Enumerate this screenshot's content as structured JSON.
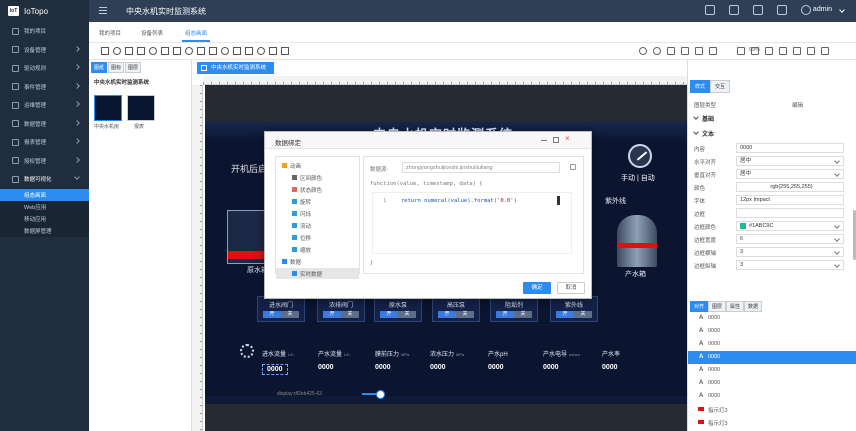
{
  "app": {
    "logo_badge": "IoT",
    "logo_text": "IoTopo",
    "window_title": "中央水机实时监测系统",
    "user": "admin"
  },
  "sidebar": {
    "items": [
      {
        "label": "我的项目",
        "chev": false
      },
      {
        "label": "设备管理",
        "chev": true
      },
      {
        "label": "驱动规则",
        "chev": true
      },
      {
        "label": "事件管理",
        "chev": true
      },
      {
        "label": "运维管理",
        "chev": true
      },
      {
        "label": "数据管理",
        "chev": true
      },
      {
        "label": "报表管理",
        "chev": true
      },
      {
        "label": "授权管理",
        "chev": true
      },
      {
        "label": "数据可视化",
        "chev": true,
        "open": true
      }
    ],
    "subitems": [
      {
        "label": "组态画面",
        "active": true
      },
      {
        "label": "Web应用"
      },
      {
        "label": "移动应用"
      },
      {
        "label": "数据屏管理"
      }
    ]
  },
  "tabs": [
    {
      "label": "我的项目"
    },
    {
      "label": "设备列表"
    },
    {
      "label": "组态画面",
      "active": true
    }
  ],
  "toolbar": {
    "zoom": "99%"
  },
  "left_panel": {
    "tabs": [
      "图纸",
      "图标",
      "图层"
    ],
    "tree_root": "中央水机实时监测系统",
    "thumbs": [
      {
        "label": "中央水机房",
        "selected": true
      },
      {
        "label": "报表"
      }
    ]
  },
  "canvas": {
    "doc_tab": "中央水机实时监测系统",
    "screen_title": "中央水机实时监测系统",
    "hint": "开机后启动",
    "left_tank_label": "原水箱",
    "right_tank_label": "产水箱",
    "uv_label": "紫外线",
    "mode_label": "手动 | 自动",
    "valves": [
      {
        "name": "进水阀门",
        "on": "开",
        "off": "关"
      },
      {
        "name": "浓排阀门",
        "on": "开",
        "off": "关"
      },
      {
        "name": "原水泵",
        "on": "开",
        "off": "关"
      },
      {
        "name": "高压泵",
        "on": "开",
        "off": "关"
      },
      {
        "name": "阻垢剂",
        "on": "开",
        "off": "关"
      },
      {
        "name": "紫外线",
        "on": "开",
        "off": "关"
      }
    ],
    "sensors": [
      {
        "name": "进水流量",
        "unit": "L/h",
        "value": "0000",
        "selected": true
      },
      {
        "name": "产水流量",
        "unit": "L/h",
        "value": "0000"
      },
      {
        "name": "膜前压力",
        "unit": "MPa",
        "value": "0000"
      },
      {
        "name": "浓水压力",
        "unit": "MPa",
        "value": "0000"
      },
      {
        "name": "产水pH",
        "unit": "",
        "value": "0000"
      },
      {
        "name": "产水电导",
        "unit": "us/cm",
        "value": "0000"
      },
      {
        "name": "产水率",
        "unit": "",
        "value": "0000"
      }
    ],
    "coord_text": "display:df2eb425-63",
    "zoom_fraction": 0.65
  },
  "modal": {
    "title": "数据绑定",
    "tree": [
      {
        "label": "动画",
        "icon_color": "#f0a020",
        "indent": 0
      },
      {
        "label": "区间颜色",
        "icon_color": "#666666",
        "indent": 1
      },
      {
        "label": "状态颜色",
        "icon_color": "#e06666",
        "indent": 1
      },
      {
        "label": "旋转",
        "icon_color": "#3399dd",
        "indent": 1
      },
      {
        "label": "闪烁",
        "icon_color": "#3399dd",
        "indent": 1
      },
      {
        "label": "流动",
        "icon_color": "#3399dd",
        "indent": 1
      },
      {
        "label": "位移",
        "icon_color": "#3399dd",
        "indent": 1
      },
      {
        "label": "缩放",
        "icon_color": "#3399dd",
        "indent": 1
      },
      {
        "label": "数据",
        "icon_color": "#2d8cf0",
        "indent": 0
      },
      {
        "label": "实时数据",
        "icon_color": "#2d8cf0",
        "indent": 1,
        "selected": true
      }
    ],
    "datasource_label": "数据源:",
    "datasource_value": "zhongyangshuijiceshi.jinshuiliuliang",
    "fn_signature": "function(value, timestamp, data) {",
    "line_number": "1",
    "code_prefix": "return numeral(value).format(",
    "code_str": "'0.0'",
    "code_suffix": ")",
    "fn_end": "}",
    "ok": "确定",
    "cancel": "取消"
  },
  "right_panel": {
    "tabs": [
      "样式",
      "交互"
    ],
    "component_type_label": "图层类型",
    "component_type_value": "编辑",
    "section_basic": "基础",
    "section_text": "文本",
    "props": [
      {
        "k": "内容",
        "v": "0000",
        "dd": false
      },
      {
        "k": "水平对齐",
        "v": "居中",
        "dd": true
      },
      {
        "k": "垂直对齐",
        "v": "居中",
        "dd": true
      },
      {
        "k": "颜色",
        "v": "rgb(255,255,255)",
        "dd": false
      },
      {
        "k": "字体",
        "v": "12px Impact",
        "dd": false
      },
      {
        "k": "边框",
        "v": "",
        "dd": false
      },
      {
        "k": "边框颜色",
        "v": "#1ABC9C",
        "dd": true,
        "swatch": "#1ABC9C"
      },
      {
        "k": "边框宽度",
        "v": "6",
        "dd": true
      },
      {
        "k": "边框横轴",
        "v": "3",
        "dd": true
      },
      {
        "k": "边框纵轴",
        "v": "3",
        "dd": true
      }
    ],
    "layer_tabs": [
      "对齐",
      "图层",
      "属性",
      "数据"
    ],
    "layers": [
      {
        "text": "0000"
      },
      {
        "text": "0000"
      },
      {
        "text": "0000"
      },
      {
        "text": "0000",
        "selected": true
      },
      {
        "text": "0000"
      },
      {
        "text": "0000"
      },
      {
        "text": "0000"
      },
      {
        "text": "指示灯3",
        "red": true
      },
      {
        "text": "指示灯3",
        "red": true
      }
    ]
  }
}
